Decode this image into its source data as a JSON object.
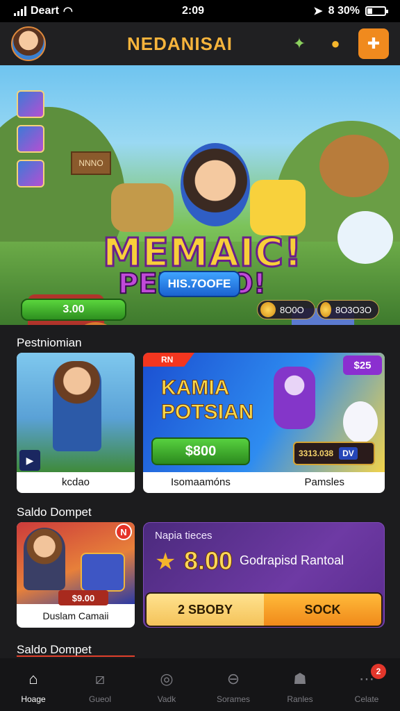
{
  "status_bar": {
    "carrier": "Deart",
    "time": "2:09",
    "battery_text": "8 30%",
    "battery_level": 0.3
  },
  "header": {
    "title": "NEDANISAI",
    "icons": [
      "gem-icon",
      "trophy-icon",
      "puzzle-icon"
    ]
  },
  "hero": {
    "sign": "NNNO",
    "title": "MEMAIC!",
    "subtitle": "PERWAO!",
    "score_button": "HIS.7OOFE",
    "price_button": "3.00",
    "pill_left": "8O0O",
    "pill_right": "8O3O3O"
  },
  "sections": {
    "first": "Pestniomian",
    "second": "Saldo Dompet",
    "third": "Saldo Dompet"
  },
  "cards": {
    "card1_label": "kcdao",
    "card2_tag": "RN",
    "card2_badge": "$25",
    "card2_title_line1": "KAMIA",
    "card2_title_line2": "POTSIAN",
    "card2_buy": "$800",
    "card2_stat": "3313.038",
    "card2_stat_tag": "DV",
    "card2_label_left": "Isomaamóns",
    "card2_label_right": "Pamsles",
    "card3_badge": "N",
    "card3_price": "$9.00",
    "card3_label": "Duslam Camaii"
  },
  "wallet": {
    "heading": "Napia tieces",
    "amount": "8.00",
    "note": "Godrapisd Rantoal",
    "left_button": "2 SBOBY",
    "right_button": "SOCK"
  },
  "tabs": [
    {
      "label": "Hoage",
      "icon": "home-icon",
      "active": true
    },
    {
      "label": "Gueol",
      "icon": "square-slash-icon"
    },
    {
      "label": "Vadk",
      "icon": "circle-icon"
    },
    {
      "label": "Sorames",
      "icon": "minus-circle-icon"
    },
    {
      "label": "Ranles",
      "icon": "person-icon"
    },
    {
      "label": "Celate",
      "icon": "ellipsis-icon",
      "badge": "2"
    }
  ]
}
